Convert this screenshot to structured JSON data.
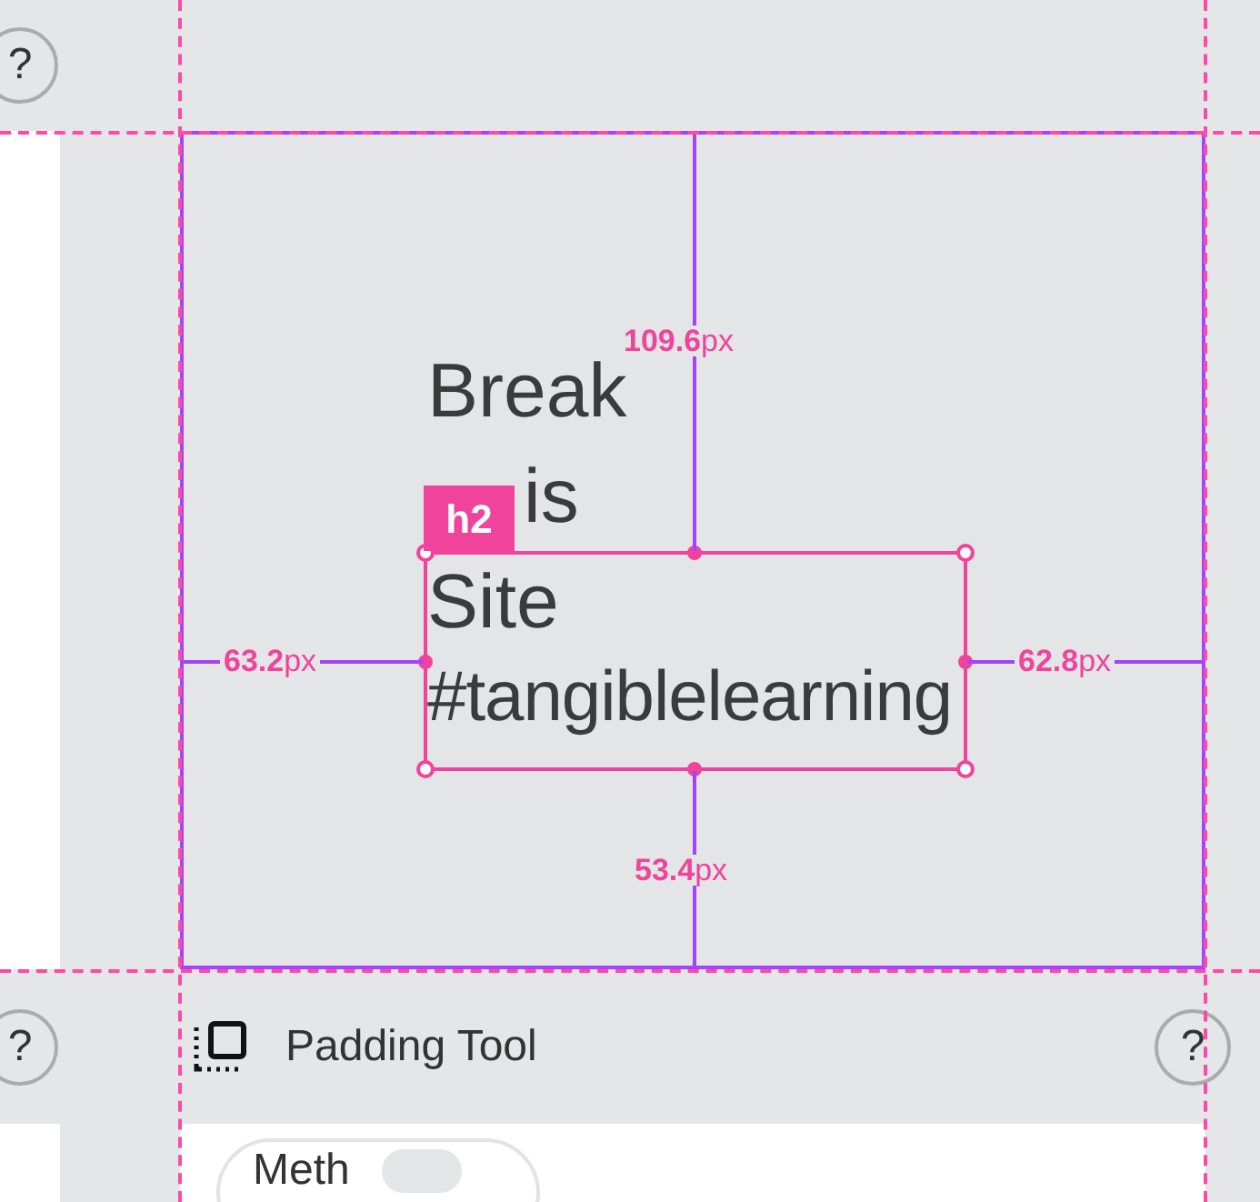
{
  "help_buttons": [
    "?",
    "?",
    "?"
  ],
  "canvas": {
    "heading_lines": [
      "Break",
      "is",
      "Site"
    ],
    "hashtag": "#tangiblelearning",
    "element_tag": "h2",
    "measurements": {
      "top": "**109.6**px",
      "left": "**63.2**px",
      "right": "**62.8**px",
      "bottom": "**53.4**px"
    }
  },
  "panel": {
    "title": "Padding Tool",
    "option": {
      "label": "Meth"
    }
  }
}
